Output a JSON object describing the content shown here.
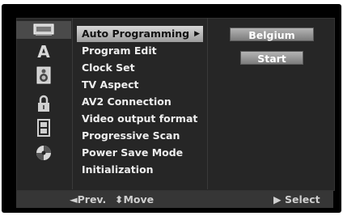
{
  "sidebar": {
    "icons": [
      {
        "name": "disc-tray-icon",
        "active": true
      },
      {
        "name": "language-a-icon",
        "glyph": "A",
        "active": false
      },
      {
        "name": "speaker-icon",
        "active": false
      },
      {
        "name": "padlock-icon",
        "active": false
      },
      {
        "name": "film-strip-icon",
        "active": false
      },
      {
        "name": "disc-icon",
        "active": false
      }
    ]
  },
  "menu": {
    "items": [
      {
        "label": "Auto Programming",
        "selected": true
      },
      {
        "label": "Program Edit"
      },
      {
        "label": "Clock Set"
      },
      {
        "label": "TV Aspect"
      },
      {
        "label": "AV2 Connection"
      },
      {
        "label": "Video output format"
      },
      {
        "label": "Progressive Scan"
      },
      {
        "label": "Power Save Mode"
      },
      {
        "label": "Initialization"
      }
    ],
    "submenu_arrow": "▶"
  },
  "options": {
    "country": "Belgium",
    "start": "Start"
  },
  "footer": {
    "prev": "◄Prev.",
    "move": "⬍Move",
    "select": "▶ Select"
  },
  "colors": {
    "background": "#000000",
    "panel": "#262626",
    "highlight": "#bcbcbc",
    "button": "#9a9a9a",
    "text": "#eeeeee",
    "footer": "#363636"
  }
}
